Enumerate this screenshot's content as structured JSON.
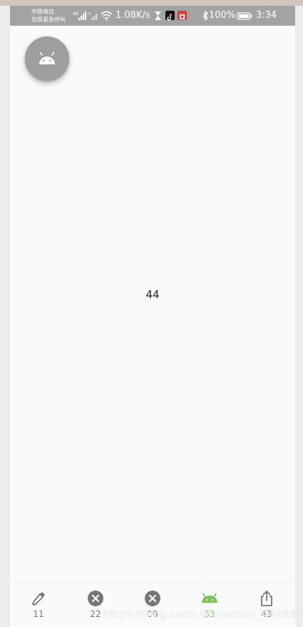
{
  "status_bar": {
    "carrier_line1": "中国电信",
    "carrier_line2": "仅限紧急呼叫",
    "speed": "1.08K/s",
    "battery": "100%",
    "time": "3:34"
  },
  "fab": {
    "icon": "android-icon"
  },
  "content": {
    "center_text": "44"
  },
  "bottom_nav": {
    "items": [
      {
        "icon": "eyedropper-icon",
        "label": "11"
      },
      {
        "icon": "close-circle-icon",
        "label": "22"
      },
      {
        "icon": "close-circle-icon",
        "label": "00"
      },
      {
        "icon": "android-icon",
        "label": "33"
      },
      {
        "icon": "share-icon",
        "label": "43"
      }
    ],
    "active_index": 3,
    "active_color": "#78c257",
    "inactive_color": "#777777"
  },
  "watermark": "https://blog.csdn.net/weixin_44489566"
}
